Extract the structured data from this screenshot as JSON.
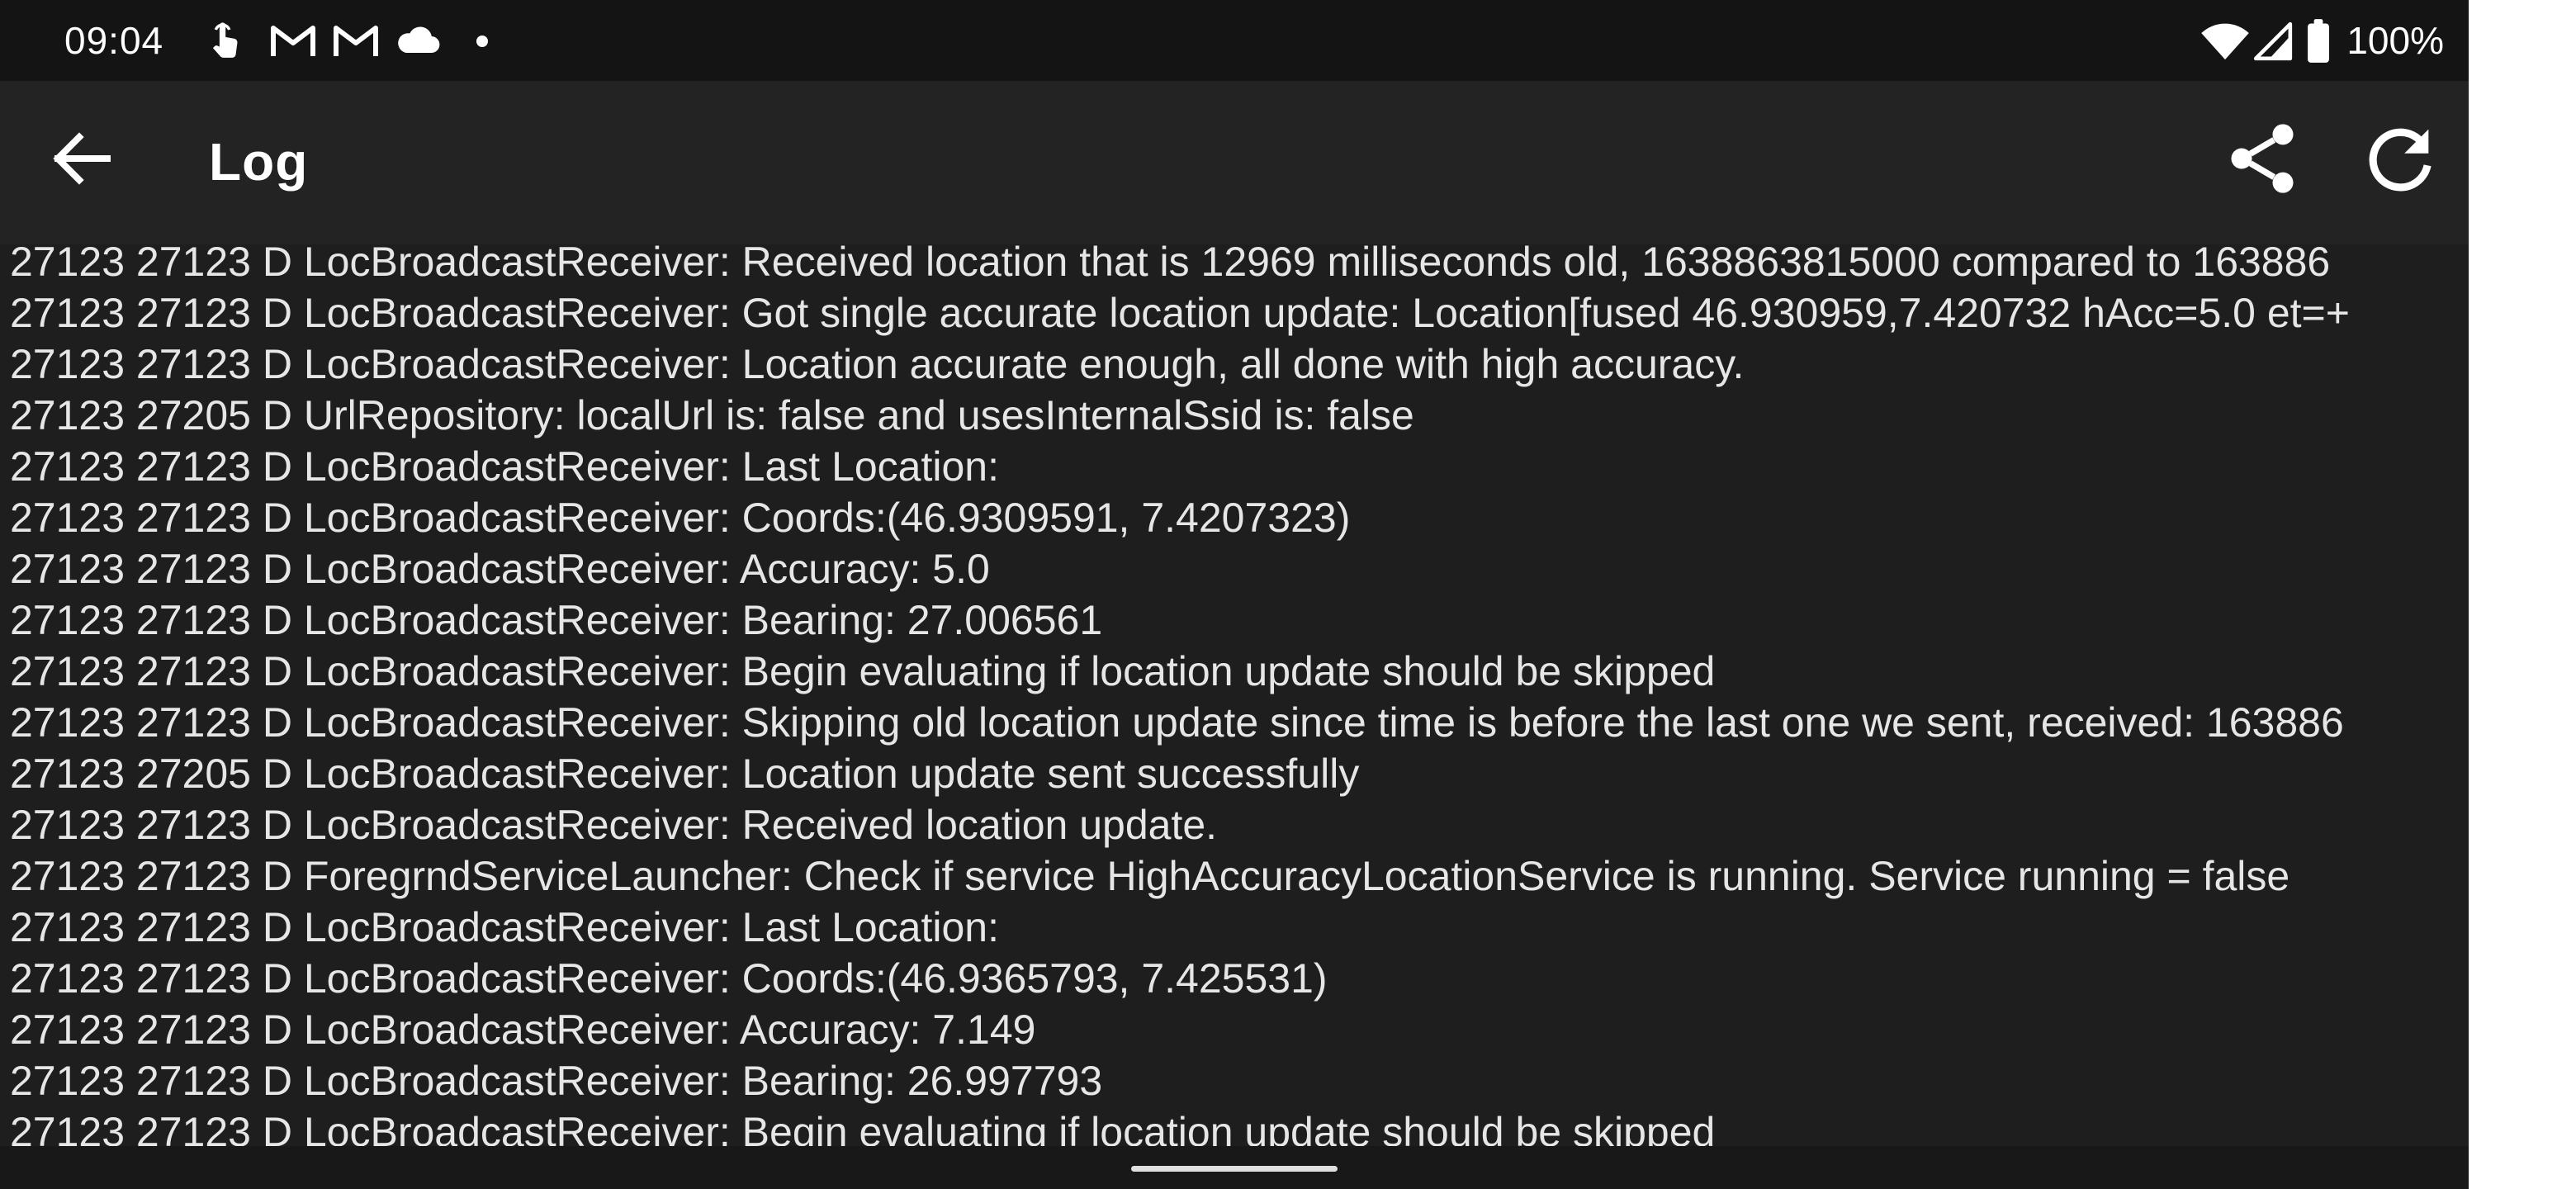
{
  "status_bar": {
    "time": "09:04",
    "battery": "100%",
    "icons": [
      "touch-icon",
      "gmail-icon",
      "gmail-icon",
      "cloud-icon",
      "dot-icon",
      "wifi-icon",
      "signal-icon",
      "battery-icon"
    ]
  },
  "app_bar": {
    "title": "Log",
    "back_icon": "arrow-left-icon",
    "share_icon": "share-icon",
    "refresh_icon": "refresh-icon"
  },
  "colors": {
    "background": "#1e1e1e",
    "app_bar": "#232323",
    "status_bar": "#141414",
    "text": "#e6e6e6"
  },
  "log_lines": [
    "27123 27123 D LocBroadcastReceiver: Received location that is 12969 milliseconds old, 1638863815000 compared to 163886",
    "27123 27123 D LocBroadcastReceiver: Got single accurate location update: Location[fused 46.930959,7.420732 hAcc=5.0 et=+",
    "27123 27123 D LocBroadcastReceiver: Location accurate enough, all done with high accuracy.",
    "27123 27205 D UrlRepository: localUrl is: false and usesInternalSsid is: false",
    "27123 27123 D LocBroadcastReceiver: Last Location:",
    "27123 27123 D LocBroadcastReceiver: Coords:(46.9309591, 7.4207323)",
    "27123 27123 D LocBroadcastReceiver: Accuracy: 5.0",
    "27123 27123 D LocBroadcastReceiver: Bearing: 27.006561",
    "27123 27123 D LocBroadcastReceiver: Begin evaluating if location update should be skipped",
    "27123 27123 D LocBroadcastReceiver: Skipping old location update since time is before the last one we sent, received: 163886",
    "27123 27205 D LocBroadcastReceiver: Location update sent successfully",
    "27123 27123 D LocBroadcastReceiver: Received location update.",
    "27123 27123 D ForegrndServiceLauncher: Check if service HighAccuracyLocationService is running. Service running = false",
    "27123 27123 D LocBroadcastReceiver: Last Location:",
    "27123 27123 D LocBroadcastReceiver: Coords:(46.9365793, 7.425531)",
    "27123 27123 D LocBroadcastReceiver: Accuracy: 7.149",
    "27123 27123 D LocBroadcastReceiver: Bearing: 26.997793",
    "27123 27123 D LocBroadcastReceiver: Begin evaluating if location update should be skipped"
  ]
}
